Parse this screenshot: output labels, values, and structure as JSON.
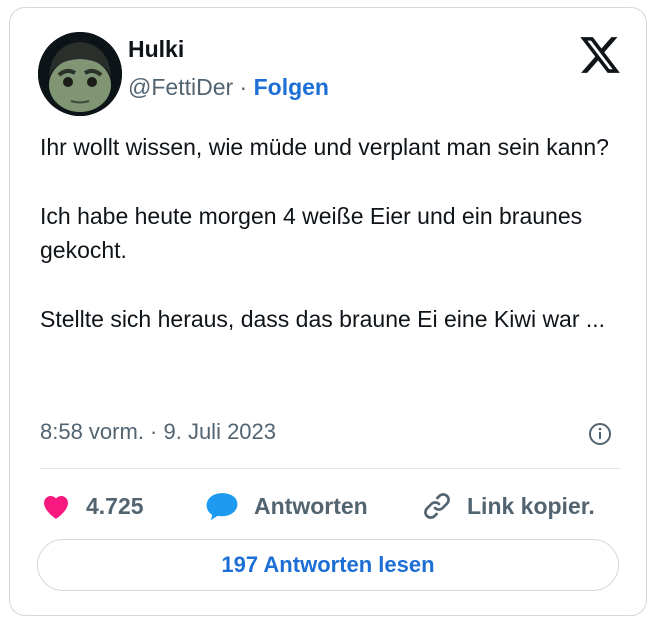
{
  "author": {
    "display_name": "Hulki",
    "handle": "@FettiDer",
    "separator": "·",
    "follow_label": "Folgen",
    "avatar_icon": "bobblehead-avatar"
  },
  "platform_icon": "x-logo-icon",
  "tweet": {
    "paragraphs": [
      "Ihr wollt wissen, wie müde und verplant man sein kann?",
      "Ich habe heute morgen 4 weiße Eier und ein braunes gekocht.",
      "Stellte sich heraus, dass das braune Ei eine Kiwi war ..."
    ],
    "timestamp": "8:58 vorm. · 9. Juli 2023"
  },
  "actions": {
    "likes_count": "4.725",
    "reply_label": "Antworten",
    "copy_link_label": "Link kopier."
  },
  "read_replies_label": "197 Antworten lesen",
  "colors": {
    "accent": "#1d6fd6",
    "like": "#f91880",
    "reply": "#1d9bf0",
    "muted_text": "#536471",
    "border": "#cfd9de"
  }
}
